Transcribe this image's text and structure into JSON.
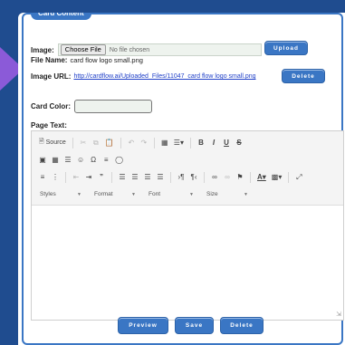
{
  "legend": "Card Content",
  "image": {
    "label": "Image:",
    "choose_label": "Choose File",
    "no_file": "No file chosen",
    "upload_label": "Upload"
  },
  "file_name": {
    "label": "File Name:",
    "value": "card flow logo small.png"
  },
  "image_url": {
    "label": "Image URL:",
    "link": "http://cardflow.ai/Uploaded_Files/11047_card flow logo small.png",
    "delete_label": "Delete"
  },
  "card_color": {
    "label": "Card Color:",
    "value": ""
  },
  "page_text": {
    "label": "Page Text:"
  },
  "toolbar": {
    "source_label": "Source",
    "styles_label": "Styles",
    "format_label": "Format",
    "font_label": "Font",
    "size_label": "Size"
  },
  "actions": {
    "preview": "Preview",
    "save": "Save",
    "delete": "Delete"
  },
  "colors": {
    "accent": "#3a76c4",
    "background": "#1f4c8f",
    "arrow": "#8b5ad8"
  }
}
